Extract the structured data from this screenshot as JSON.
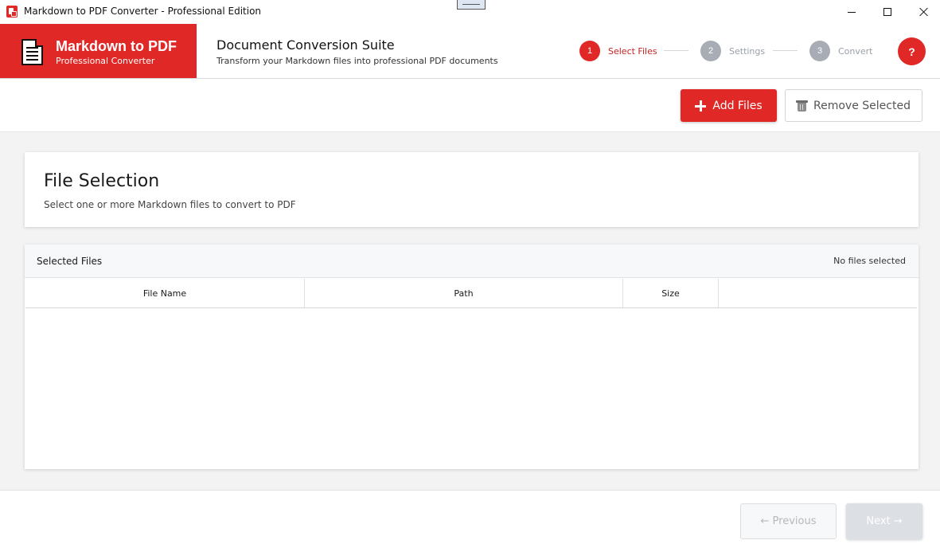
{
  "window": {
    "title": "Markdown to PDF Converter - Professional Edition",
    "icons": {
      "app": "pdf-app-icon",
      "minimize": "minimize-icon",
      "maximize": "maximize-icon",
      "close": "close-icon"
    }
  },
  "brand": {
    "name": "Markdown to PDF",
    "subtitle": "Professional Converter",
    "icon": "document-icon",
    "color": "#e02826"
  },
  "header": {
    "title": "Document Conversion Suite",
    "subtitle": "Transform your Markdown files into professional PDF documents",
    "help_label": "?"
  },
  "steps": [
    {
      "number": "1",
      "label": "Select Files",
      "active": true
    },
    {
      "number": "2",
      "label": "Settings",
      "active": false
    },
    {
      "number": "3",
      "label": "Convert",
      "active": false
    }
  ],
  "toolbar": {
    "add_label": "Add Files",
    "remove_label": "Remove Selected"
  },
  "intro": {
    "heading": "File Selection",
    "description": "Select one or more Markdown files to convert to PDF"
  },
  "files": {
    "title": "Selected Files",
    "count_text": "No files selected",
    "columns": [
      "File Name",
      "Path",
      "Size",
      ""
    ],
    "rows": []
  },
  "footer": {
    "previous_label": "← Previous",
    "next_label": "Next →"
  },
  "colors": {
    "accent": "#e02826",
    "step_inactive": "#a7acb5",
    "disabled_button": "#dcdfe4"
  }
}
